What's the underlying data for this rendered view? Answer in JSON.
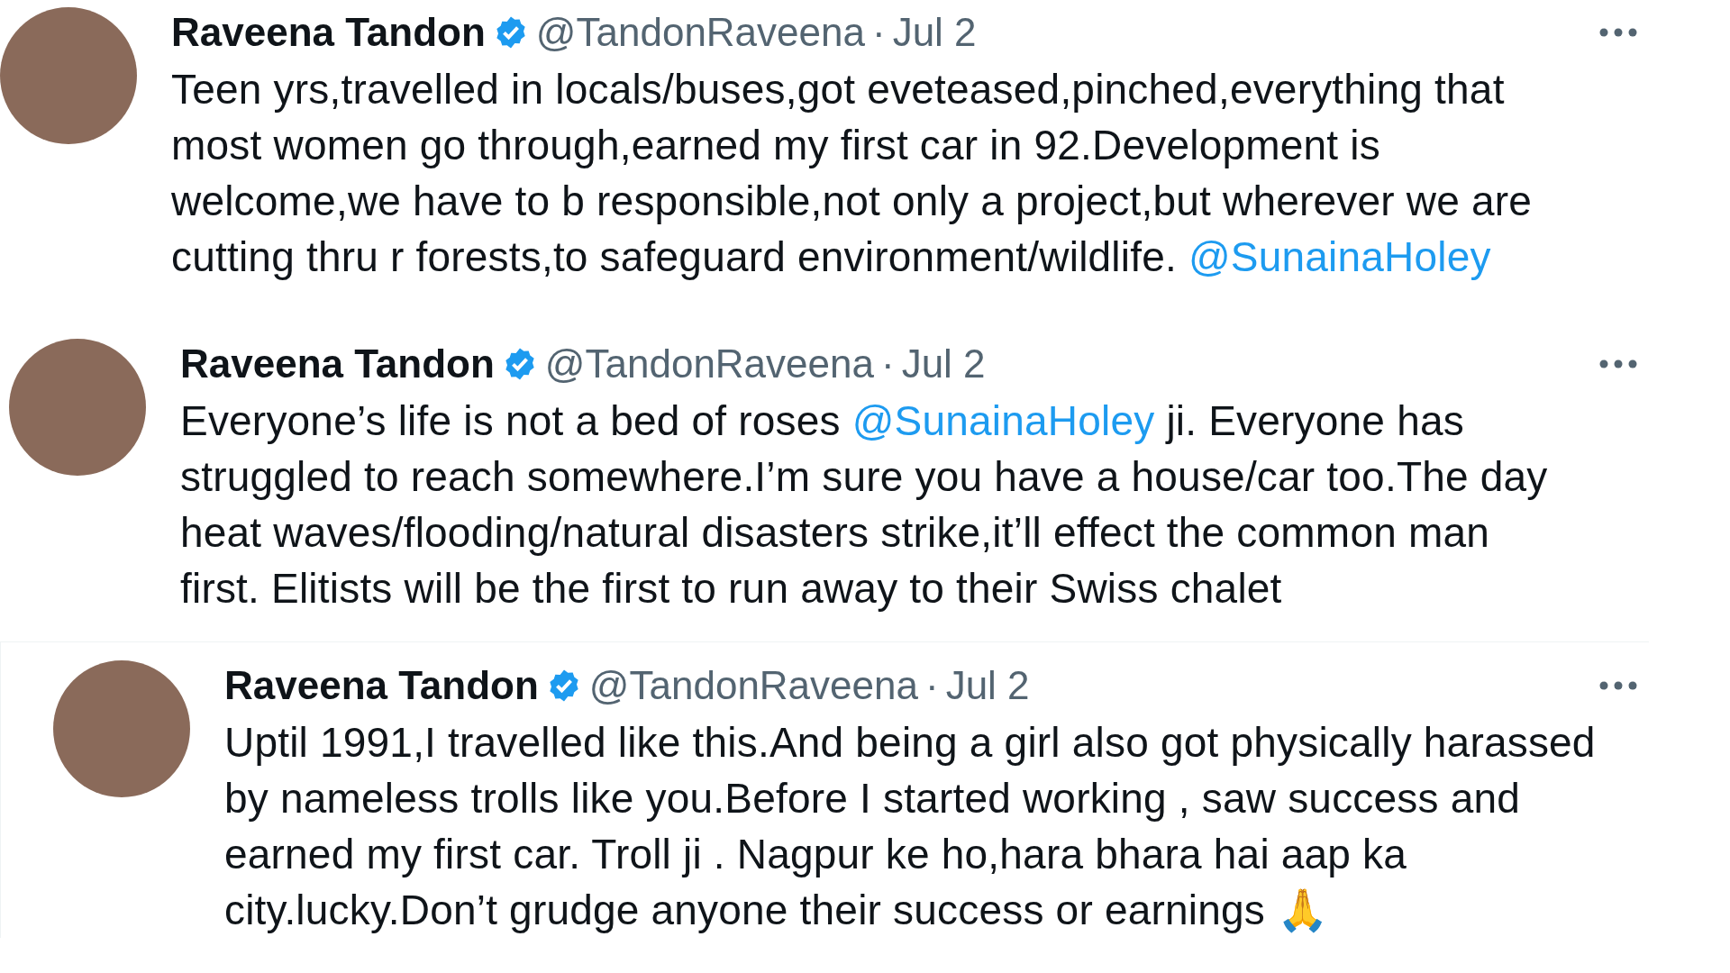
{
  "tweets": [
    {
      "name": "Raveena Tandon",
      "verified": true,
      "handle": "@TandonRaveena",
      "separator": "·",
      "date": "Jul 2",
      "lines": [
        [
          {
            "kind": "plain",
            "text": "Teen yrs,travelled in locals/buses,got eveteased,pinched,everything that"
          }
        ],
        [
          {
            "kind": "plain",
            "text": "most women go through,earned my first car in 92.Development is"
          }
        ],
        [
          {
            "kind": "plain",
            "text": "welcome,we have to b responsible,not only a project,but wherever we are"
          }
        ],
        [
          {
            "kind": "plain",
            "text": "cutting thru r forests,to safeguard environment/wildlife. "
          },
          {
            "kind": "mention",
            "text": "@SunainaHoley"
          }
        ]
      ]
    },
    {
      "name": "Raveena Tandon",
      "verified": true,
      "handle": "@TandonRaveena",
      "separator": "·",
      "date": "Jul 2",
      "lines": [
        [
          {
            "kind": "plain",
            "text": "Everyone’s life is not a bed of roses "
          },
          {
            "kind": "mention",
            "text": "@SunainaHoley"
          },
          {
            "kind": "plain",
            "text": " ji. Everyone has"
          }
        ],
        [
          {
            "kind": "plain",
            "text": "struggled to reach somewhere.I’m sure you have a house/car too.The day"
          }
        ],
        [
          {
            "kind": "plain",
            "text": "heat waves/flooding/natural disasters strike,it’ll effect the common man"
          }
        ],
        [
          {
            "kind": "plain",
            "text": "first. Elitists will be the first to run away to their Swiss chalet"
          }
        ]
      ]
    },
    {
      "name": "Raveena Tandon",
      "verified": true,
      "handle": "@TandonRaveena",
      "separator": "·",
      "date": "Jul 2",
      "lines": [
        [
          {
            "kind": "plain",
            "text": "Uptil 1991,I travelled like this.And being a girl also got physically harassed"
          }
        ],
        [
          {
            "kind": "plain",
            "text": "by nameless trolls like you.Before I started working , saw success and"
          }
        ],
        [
          {
            "kind": "plain",
            "text": "earned my first car. Troll ji . Nagpur ke ho,hara bhara hai aap ka"
          }
        ],
        [
          {
            "kind": "plain",
            "text": "city.lucky.Don’t grudge anyone their success or earnings 🙏"
          }
        ]
      ]
    }
  ]
}
